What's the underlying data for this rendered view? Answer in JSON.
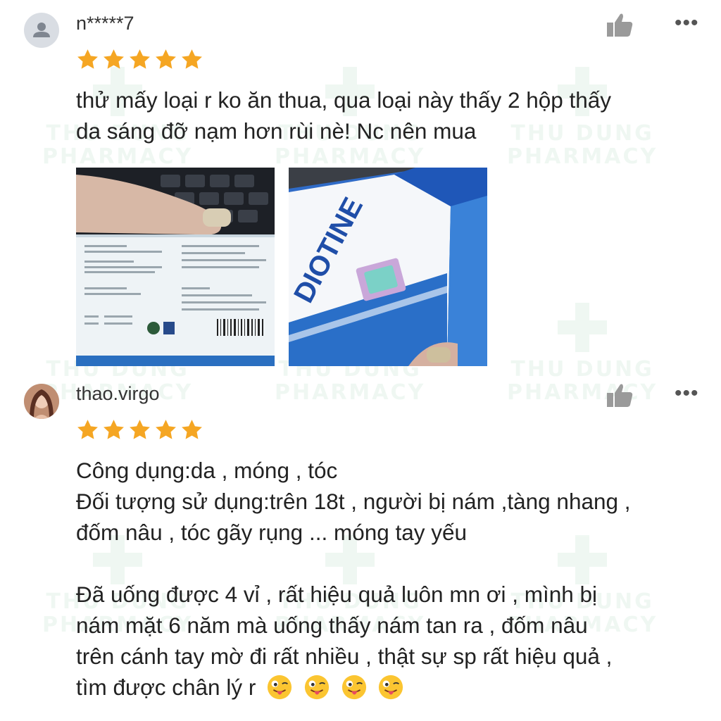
{
  "watermark": {
    "line1": "THU DUNG",
    "line2": "PHARMACY"
  },
  "colors": {
    "star": "#f5a623",
    "text": "#222222",
    "watermark": "#2e9e57"
  },
  "reviews": [
    {
      "username": "n*****7",
      "rating": 5,
      "text_lines": [
        "thử mấy loại r ko ăn thua, qua loại này thấy 2 hộp thấy",
        "da sáng đỡ nạm hơn rùi nè! Nc nên mua"
      ],
      "photos": [
        {
          "icon": "product-box-back-photo",
          "brand": ""
        },
        {
          "icon": "product-box-front-photo",
          "brand": "DIOTINE"
        }
      ]
    },
    {
      "username": "thao.virgo",
      "rating": 5,
      "text_lines": [
        "Công dụng:da , móng , tóc",
        "Đối tượng sử dụng:trên 18t , người bị nám ,tàng nhang ,",
        "đốm nâu , tóc gãy rụng ... móng tay yếu",
        "",
        "Đã uống được 4 vỉ , rất hiệu quả luôn mn ơi , mình bị",
        "nám mặt 6 năm mà uống thấy nám tan ra , đốm nâu",
        "trên cánh tay mờ đi rất nhiều , thật sự sp rất hiệu quả ,",
        "tìm được chân lý r"
      ],
      "emojis": [
        "winking-tongue-emoji",
        "winking-tongue-emoji",
        "winking-tongue-emoji",
        "winking-tongue-emoji"
      ]
    }
  ],
  "icons": {
    "like": "thumbs-up-icon",
    "more": "more-options-icon",
    "more_glyph": "•••"
  }
}
